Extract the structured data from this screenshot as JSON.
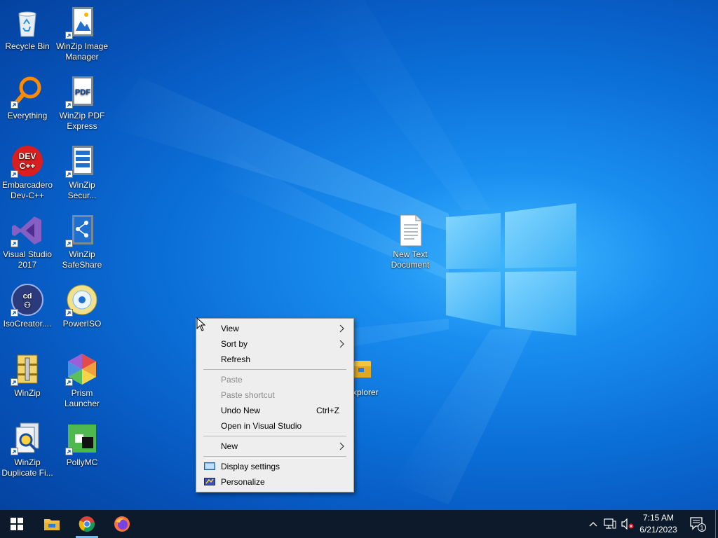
{
  "desktop": {
    "icons": [
      {
        "label": "Recycle Bin",
        "icon": "recycle-bin-icon"
      },
      {
        "label": "WinZip Image Manager",
        "icon": "winzip-image-manager-icon"
      },
      {
        "label": "Everything",
        "icon": "everything-search-icon"
      },
      {
        "label": "WinZip PDF Express",
        "icon": "winzip-pdf-express-icon"
      },
      {
        "label": "Embarcadero Dev-C++",
        "icon": "dev-cpp-icon"
      },
      {
        "label": "WinZip Secur...",
        "icon": "winzip-secure-icon"
      },
      {
        "label": "Visual Studio 2017",
        "icon": "visual-studio-icon"
      },
      {
        "label": "WinZip SafeShare",
        "icon": "winzip-safeshare-icon"
      },
      {
        "label": "IsoCreator....",
        "icon": "isocreator-icon"
      },
      {
        "label": "PowerISO",
        "icon": "poweriso-icon"
      },
      {
        "label": "WinZip",
        "icon": "winzip-icon"
      },
      {
        "label": "Prism Launcher",
        "icon": "prism-launcher-icon"
      },
      {
        "label": "WinZip Duplicate Fi...",
        "icon": "winzip-duplicate-finder-icon"
      },
      {
        "label": "PollyMC",
        "icon": "pollymc-icon"
      },
      {
        "label": "New Text Document",
        "icon": "text-document-icon"
      },
      {
        "label": "xplorer",
        "icon": "folder-icon"
      }
    ],
    "pdf_badge": "PDF",
    "devcpp_badge": [
      "DEV",
      "C++"
    ]
  },
  "context_menu": {
    "items": [
      {
        "label": "View",
        "submenu": true,
        "enabled": true
      },
      {
        "label": "Sort by",
        "submenu": true,
        "enabled": true
      },
      {
        "label": "Refresh",
        "enabled": true
      },
      {
        "label": "Paste",
        "enabled": false
      },
      {
        "label": "Paste shortcut",
        "enabled": false
      },
      {
        "label": "Undo New",
        "shortcut": "Ctrl+Z",
        "enabled": true
      },
      {
        "label": "Open in Visual Studio",
        "enabled": true
      },
      {
        "label": "New",
        "submenu": true,
        "enabled": true
      },
      {
        "label": "Display settings",
        "icon": "display-settings-icon",
        "enabled": true
      },
      {
        "label": "Personalize",
        "icon": "personalize-icon",
        "enabled": true
      }
    ]
  },
  "taskbar": {
    "start": "windows-start-icon",
    "pinned": [
      "file-explorer-icon",
      "chrome-icon",
      "firefox-icon"
    ],
    "tray": {
      "icons": [
        "show-hidden-icons-chevron",
        "network-icon",
        "volume-muted-icon"
      ],
      "time": "7:15 AM",
      "date": "6/21/2023",
      "notification_count": "1"
    }
  },
  "colors": {
    "taskbar": "#0c1a2b",
    "menu_bg": "#eeeeee",
    "desktop_accent": "#0b6fd8"
  }
}
